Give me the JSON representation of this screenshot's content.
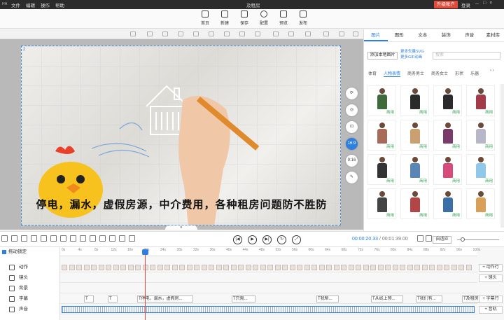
{
  "topbar": {
    "logo": "HH",
    "menu": [
      "文件",
      "编辑",
      "操作",
      "帮助"
    ],
    "title": "及租房",
    "upgrade": "升级账户",
    "login": "登录",
    "window_controls": [
      "－",
      "□",
      "×"
    ]
  },
  "toolbar": {
    "items": [
      {
        "label": "首页",
        "icon": "home-icon"
      },
      {
        "label": "新建",
        "icon": "new-icon"
      },
      {
        "label": "保存",
        "icon": "save-icon"
      },
      {
        "label": "配置",
        "icon": "settings-icon"
      },
      {
        "label": "预览",
        "icon": "preview-icon"
      },
      {
        "label": "发布",
        "icon": "publish-icon"
      }
    ]
  },
  "canvas": {
    "scene_number": "2",
    "caption": "停电，漏水，虚假房源，中介费用，各种租房问题防不胜防",
    "side_tools": [
      "⟳",
      "◎",
      "⊡",
      "16:9",
      "9:16",
      "✎"
    ],
    "collapse": "≡"
  },
  "right_panel": {
    "tabs": [
      "图片",
      "图形",
      "文本",
      "装饰",
      "声音",
      "素材库"
    ],
    "add_local": "添加本地图片",
    "more_links": [
      "更多矢量SVG",
      "更多GIF动画"
    ],
    "search_placeholder": "搜索",
    "categories": [
      "体育",
      "人物表情",
      "商务男士",
      "商务女士",
      "形状",
      "乐器"
    ],
    "active_category": "人物表情",
    "thumb_tag": "商用",
    "thumbs": [
      {
        "color": "#3f6a3a"
      },
      {
        "color": "#2a2a2a"
      },
      {
        "color": "#2b2b2b"
      },
      {
        "color": "#a33a4a"
      },
      {
        "color": "#a86b5a"
      },
      {
        "color": "#caa070"
      },
      {
        "color": "#7a3b6b"
      },
      {
        "color": "#b7b7c7"
      },
      {
        "color": "#333333"
      },
      {
        "color": "#5a86b5"
      },
      {
        "color": "#d64b7a"
      },
      {
        "color": "#8fc8e8"
      },
      {
        "color": "#444444"
      },
      {
        "color": "#b24545"
      },
      {
        "color": "#3b6fa8"
      },
      {
        "color": "#d9a05a"
      }
    ]
  },
  "transport": {
    "current_time": "00:00:20.33",
    "total_time": "00:01:39.00",
    "adapt": "自适应",
    "zoom_level": 0.1
  },
  "timeline": {
    "ruler_ticks": [
      "0s",
      "4s",
      "8s",
      "12s",
      "16s",
      "20s",
      "24s",
      "28s",
      "32s",
      "36s",
      "40s",
      "44s",
      "48s",
      "52s",
      "56s",
      "60s",
      "64s",
      "68s",
      "72s",
      "76s",
      "80s",
      "84s",
      "88s",
      "92s",
      "96s",
      "100s"
    ],
    "lock_label": "拖动锁定",
    "rows": [
      {
        "label": "动作",
        "add": "+ 动作行"
      },
      {
        "label": "镜头",
        "add": "+ 镜头"
      },
      {
        "label": "背景",
        "add": ""
      },
      {
        "label": "字幕",
        "add": "+ 字幕行"
      },
      {
        "label": "声音",
        "add": "+ 音轨"
      }
    ],
    "subtitles": [
      "T",
      "T",
      "T停电，漏水，虚假房...",
      "T只需...",
      "T我帮...",
      "T从线上预...",
      "T我们有...",
      "T及租房..."
    ]
  }
}
